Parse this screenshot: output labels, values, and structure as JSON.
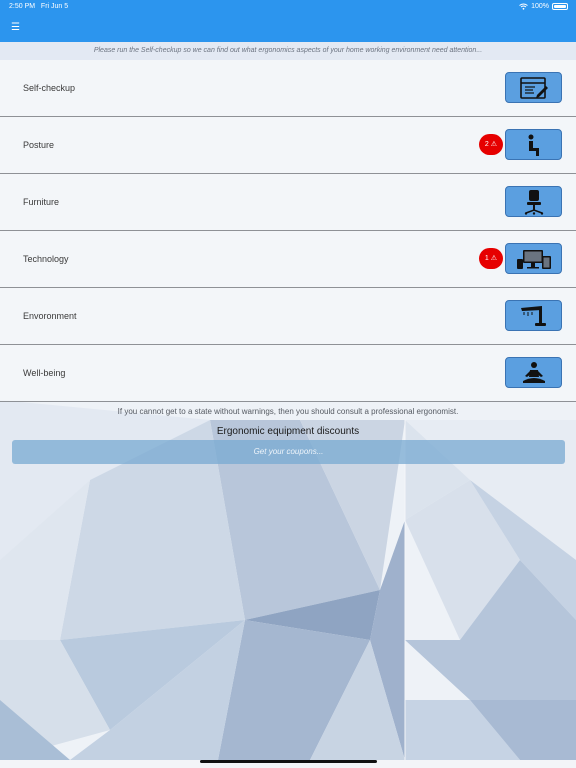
{
  "status_bar": {
    "time": "2:50 PM",
    "date": "Fri Jun 5",
    "battery": "100%"
  },
  "banner": "Please run the Self-checkup so we can find out what ergonomics aspects of your home working environment need attention...",
  "categories": [
    {
      "label": "Self-checkup",
      "icon": "checklist-icon"
    },
    {
      "label": "Posture",
      "icon": "sitting-person-icon",
      "warning_count": "2"
    },
    {
      "label": "Furniture",
      "icon": "office-chair-icon"
    },
    {
      "label": "Technology",
      "icon": "devices-icon",
      "warning_count": "1"
    },
    {
      "label": "Envoronment",
      "icon": "desk-lamp-icon"
    },
    {
      "label": "Well-being",
      "icon": "meditation-icon"
    }
  ],
  "note": "If you cannot get to a state without warnings, then you should consult a professional ergonomist.",
  "discounts": {
    "title": "Ergonomic equipment discounts",
    "button": "Get your coupons..."
  },
  "colors": {
    "header": "#2c95ee",
    "icon_button": "#5b9fe0",
    "warning": "#e60000"
  }
}
